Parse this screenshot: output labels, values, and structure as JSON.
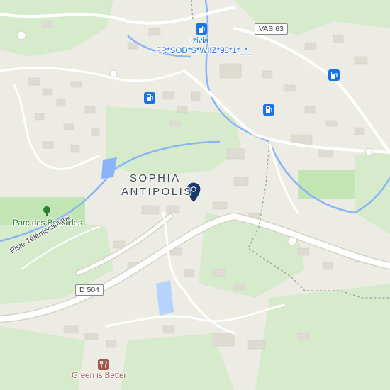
{
  "map": {
    "colors": {
      "background": "#ecebe4",
      "green_area": "#d6ebcc",
      "park": "#c2e5b4",
      "water": "#8ab4f8",
      "road": "#ffffff",
      "road_casing": "#d6d2c6",
      "building": "#dedbd2",
      "pin": "#1a3a6b",
      "poi_blue": "#1a73e8",
      "poi_brown": "#a1574a"
    },
    "place_label": {
      "line1": "SOPHIA",
      "line2": "ANTIPOLIS"
    },
    "poi": {
      "izivia_name": "Izivia",
      "izivia_code": "FR*SOD*S*WIIZ*98*1*_*_",
      "park_name": "Parc des Bouillides",
      "restaurant_name": "Green is Better"
    },
    "roads": {
      "shield_vas": "VAS 63",
      "shield_d504": "D 504",
      "path_name": "Piste Télémécanique"
    },
    "icons": {
      "fuel": "ev-charging-station-icon",
      "park": "tree-icon",
      "restaurant": "fork-knife-icon",
      "pin": "location-pin-icon"
    }
  }
}
